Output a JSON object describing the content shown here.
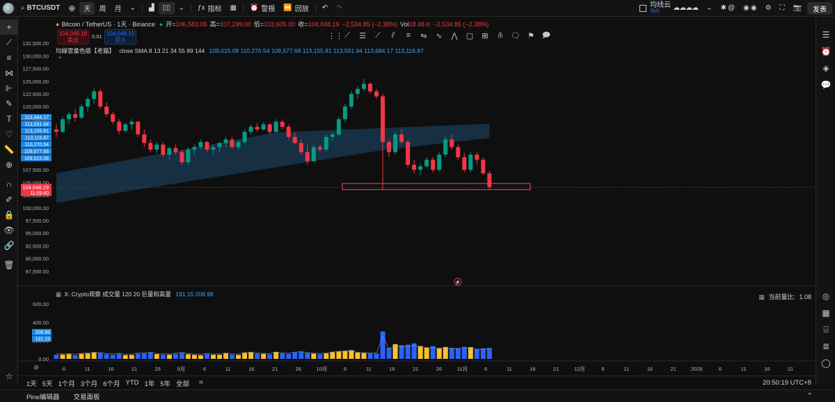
{
  "toolbar": {
    "symbol": "BTCUSDT",
    "interval_day": "天",
    "interval_week": "周",
    "interval_month": "月",
    "indicators": "指标",
    "alert": "警报",
    "replay": "回放",
    "layout_name": "均线云",
    "layout_sub": "保存",
    "publish": "发表"
  },
  "legend": {
    "currency": "USDT",
    "title": "Bitcoin / TetherUS · 1天 · Binance",
    "open_label": "开=",
    "open": "106,583.05",
    "high_label": "高=",
    "high": "107,299.00",
    "low_label": "低=",
    "low": "103,605.00",
    "close_label": "收=",
    "close": "104,048.19",
    "change": "−2,534.85 (−2.38%)",
    "vol_label": "Vol",
    "vol": "18.48 K",
    "vol_change": "−2,534.85 (−2.38%)"
  },
  "order": {
    "sell_price": "104,048.18",
    "sell_label": "卖出",
    "spread": "0.01",
    "buy_price": "104,048.19",
    "buy_label": "买入"
  },
  "indicator": {
    "name": "均線雲彙色版【老貓】",
    "params": "close SMA 8 13 21 34 55 89 144",
    "values": "109,015.08  110,270.54  109,577.68  113,155.81  113,591.94  113,684.17  113,116.87"
  },
  "volume_indicator": {
    "name": "X: Crypto观察 成交量 120 20 巨量和高量",
    "values": "191.15  208.98",
    "ratio_label": "当前量比:",
    "ratio": "1.08"
  },
  "price_axis": {
    "ticks": [
      "132,500.00",
      "130,000.00",
      "127,500.00",
      "125,000.00",
      "122,500.00",
      "120,000.00",
      "117,500.00",
      "115,000.00",
      "112,500.00",
      "110,000.00",
      "107,500.00",
      "105,000.00",
      "102,500.00",
      "100,000.00",
      "97,500.00",
      "95,000.00",
      "92,500.00",
      "90,000.00",
      "87,500.00"
    ],
    "labels_blue": [
      "113,684.17",
      "113,591.94",
      "113,155.81",
      "113,116.87",
      "110,270.54",
      "109,577.68",
      "109,015.08"
    ],
    "current_price": "104,048.19",
    "countdown": "11:09:40"
  },
  "volume_axis": {
    "ticks": [
      "600.00",
      "400.00",
      "200.00",
      "0.00"
    ],
    "labels_blue": [
      "208.98",
      "191.15"
    ]
  },
  "time_axis": [
    "6",
    "11",
    "16",
    "21",
    "26",
    "9月",
    "6",
    "11",
    "16",
    "21",
    "26",
    "10月",
    "6",
    "11",
    "16",
    "21",
    "26",
    "11月",
    "6",
    "11",
    "16",
    "21",
    "12月",
    "6",
    "11",
    "16",
    "21",
    "2026",
    "6",
    "11",
    "16",
    "21"
  ],
  "ranges": [
    "1天",
    "5天",
    "1个月",
    "3个月",
    "6个月",
    "YTD",
    "1年",
    "5年",
    "全部"
  ],
  "clock": "20:50:19 UTC+8",
  "status": [
    "Pine编辑器",
    "交易面板"
  ],
  "colors": {
    "up": "#089981",
    "down": "#f23645",
    "bull_vol": "#fbc02d",
    "bear_vol": "#2962ff",
    "cloud": "#1e4a6e",
    "accent": "#2962ff"
  },
  "chart_data": {
    "type": "candlestick",
    "ylim": [
      85000,
      135000
    ],
    "approx_candles": [
      [
        115500,
        116500,
        114000,
        115000
      ],
      [
        115000,
        118000,
        114800,
        117500
      ],
      [
        117500,
        119000,
        116500,
        118500
      ],
      [
        118500,
        119500,
        117000,
        117800
      ],
      [
        117800,
        120500,
        117500,
        120000
      ],
      [
        120000,
        122000,
        119000,
        121500
      ],
      [
        121500,
        123500,
        120500,
        123000
      ],
      [
        123000,
        123500,
        119500,
        120000
      ],
      [
        120000,
        120800,
        118000,
        118500
      ],
      [
        118500,
        119000,
        116500,
        117000
      ],
      [
        117000,
        117500,
        114500,
        115200
      ],
      [
        115200,
        116800,
        114800,
        116500
      ],
      [
        116500,
        117500,
        115500,
        117000
      ],
      [
        117000,
        117200,
        114000,
        114500
      ],
      [
        114500,
        115500,
        112000,
        112800
      ],
      [
        112800,
        113500,
        111000,
        111500
      ],
      [
        111500,
        113000,
        110800,
        112500
      ],
      [
        112500,
        113000,
        110000,
        110500
      ],
      [
        110500,
        112000,
        109500,
        111800
      ],
      [
        111800,
        112500,
        110500,
        111000
      ],
      [
        111000,
        111500,
        108500,
        109000
      ],
      [
        109000,
        112000,
        108500,
        111500
      ],
      [
        111500,
        112500,
        110500,
        112000
      ],
      [
        112000,
        113500,
        111500,
        113000
      ],
      [
        113000,
        113200,
        111000,
        111500
      ],
      [
        111500,
        112500,
        110500,
        112000
      ],
      [
        112000,
        113000,
        111000,
        112800
      ],
      [
        112800,
        114000,
        112000,
        113500
      ],
      [
        113500,
        114000,
        111800,
        112000
      ],
      [
        112000,
        113500,
        111500,
        113000
      ],
      [
        113000,
        115500,
        112500,
        115000
      ],
      [
        115000,
        116500,
        114500,
        116000
      ],
      [
        116000,
        116800,
        115000,
        115500
      ],
      [
        115500,
        117000,
        115200,
        116500
      ],
      [
        116500,
        116800,
        114500,
        115000
      ],
      [
        115000,
        117500,
        114800,
        117000
      ],
      [
        117000,
        117500,
        115500,
        116000
      ],
      [
        116000,
        116500,
        113500,
        114000
      ],
      [
        114000,
        115000,
        112500,
        112800
      ],
      [
        112800,
        113500,
        110500,
        111000
      ],
      [
        111000,
        112500,
        108500,
        109200
      ],
      [
        109200,
        112500,
        109000,
        112000
      ],
      [
        112000,
        112500,
        111000,
        111500
      ],
      [
        111500,
        114500,
        111000,
        114000
      ],
      [
        114000,
        115000,
        113200,
        114500
      ],
      [
        114500,
        118000,
        114000,
        117500
      ],
      [
        117500,
        120500,
        117000,
        120000
      ],
      [
        120000,
        123000,
        119500,
        122500
      ],
      [
        122500,
        124000,
        121500,
        123500
      ],
      [
        123500,
        125500,
        123000,
        124500
      ],
      [
        124500,
        124800,
        122500,
        123000
      ],
      [
        123000,
        123500,
        121500,
        122000
      ],
      [
        122000,
        122500,
        103500,
        113000
      ],
      [
        113000,
        113500,
        110000,
        111000
      ],
      [
        111000,
        115000,
        110500,
        114500
      ],
      [
        114500,
        115500,
        112500,
        113000
      ],
      [
        113000,
        113500,
        108000,
        108500
      ],
      [
        108500,
        109500,
        106800,
        107500
      ],
      [
        107500,
        108800,
        106500,
        108200
      ],
      [
        108200,
        110000,
        107800,
        109500
      ],
      [
        109500,
        110000,
        107000,
        107500
      ],
      [
        107500,
        111000,
        107200,
        110500
      ],
      [
        110500,
        114000,
        110000,
        113500
      ],
      [
        113500,
        114500,
        111500,
        112000
      ],
      [
        112000,
        112500,
        109500,
        110000
      ],
      [
        110000,
        110800,
        107000,
        107500
      ],
      [
        107500,
        111000,
        107000,
        110500
      ],
      [
        110500,
        111000,
        108500,
        109500
      ],
      [
        109500,
        110000,
        106500,
        106800
      ],
      [
        106800,
        107300,
        103600,
        104048
      ]
    ]
  }
}
